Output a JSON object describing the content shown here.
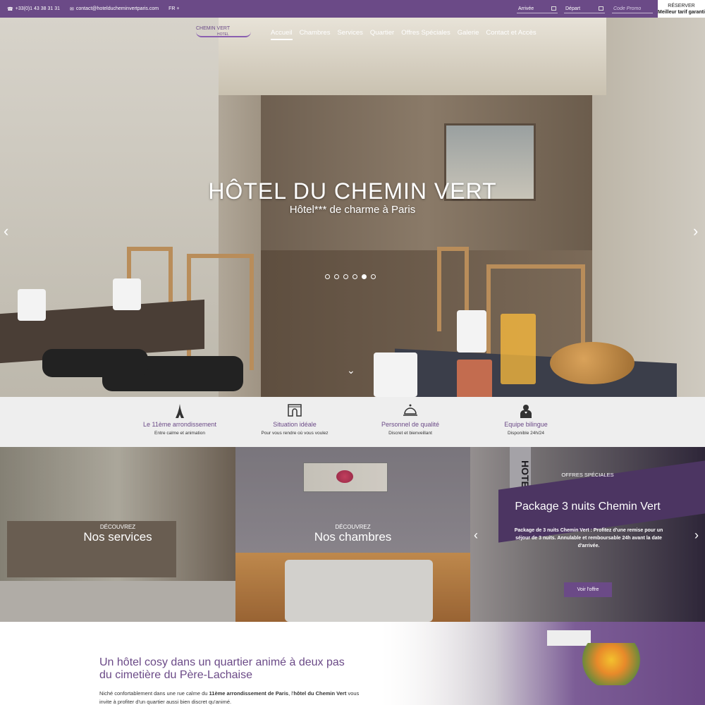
{
  "topbar": {
    "phone": "+33(0)1 43 38 31 31",
    "email": "contact@hotelducheminvertparis.com",
    "language": "FR +",
    "arrival_label": "Arrivée",
    "departure_label": "Départ",
    "promo_placeholder": "Code Promo",
    "reserve_label": "RÉSERVER",
    "reserve_sub": "Meilleur tarif garanti"
  },
  "logo": {
    "line1": "CHEMIN VERT",
    "line2": "HOTEL"
  },
  "nav": {
    "items": [
      "Accueil",
      "Chambres",
      "Services",
      "Quartier",
      "Offres Spéciales",
      "Galerie",
      "Contact et Accès"
    ],
    "active": "Accueil"
  },
  "hero": {
    "title": "HÔTEL DU CHEMIN VERT",
    "subtitle": "Hôtel*** de charme à Paris",
    "slides_count": 6,
    "active_slide": 5,
    "prev_icon": "chevron-left-icon",
    "next_icon": "chevron-right-icon",
    "scroll_icon": "chevron-down-icon"
  },
  "features": [
    {
      "icon": "eiffel-tower-icon",
      "title": "Le 11ème arrondissement",
      "subtitle": "Entre calme et animation"
    },
    {
      "icon": "arc-de-triomphe-icon",
      "title": "Situation idéale",
      "subtitle": "Pour vous rendre où vous voulez"
    },
    {
      "icon": "cloche-icon",
      "title": "Personnel de qualité",
      "subtitle": "Discret et bienveillant"
    },
    {
      "icon": "staff-person-icon",
      "title": "Equipe bilingue",
      "subtitle": "Disponible 24h/24"
    }
  ],
  "panels": {
    "services": {
      "kicker": "DÉCOUVREZ",
      "title": "Nos services"
    },
    "rooms": {
      "kicker": "DÉCOUVREZ",
      "title": "Nos chambres"
    },
    "offers": {
      "kicker": "OFFRES SPÉCIALES",
      "title": "Package 3 nuits Chemin Vert",
      "description": "Package de 3 nuits Chemin Vert : Profitez d'une remise pour un séjour de 3 nuits. Annulable et remboursable 24h avant la date d'arrivée.",
      "button": "Voir l'offre",
      "sign": "HOTEL"
    }
  },
  "intro": {
    "heading": "Un hôtel cosy dans un quartier animé à deux pas du cimetière du Père-Lachaise",
    "text_before": "Niché confortablement dans une rue calme du ",
    "text_bold1": "11ème arrondissement de Paris",
    "text_mid": ", l'",
    "text_bold2": "hôtel du Chemin Vert",
    "text_after": " vous invite à profiter d'un quartier aussi bien discret qu'animé."
  },
  "colors": {
    "accent": "#6b4a87",
    "strip_bg": "#eeeeee"
  }
}
